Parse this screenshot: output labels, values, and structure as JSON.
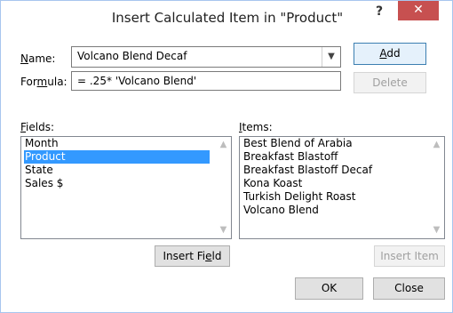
{
  "window": {
    "title": "Insert Calculated Item in \"Product\"",
    "help_label": "?",
    "close_label": "✕"
  },
  "form": {
    "name_label": "Name:",
    "name_value": "Volcano Blend Decaf",
    "formula_label": "Formula:",
    "formula_value": "= .25* 'Volcano Blend'"
  },
  "buttons": {
    "add": "Add",
    "delete": "Delete",
    "insert_field": "Insert Field",
    "insert_item": "Insert Item",
    "ok": "OK",
    "close": "Close"
  },
  "fields": {
    "label": "Fields:",
    "items": [
      "Month",
      "Product",
      "State",
      "Sales $"
    ],
    "selected": "Product"
  },
  "items": {
    "label": "Items:",
    "items": [
      "Best Blend of Arabia",
      "Breakfast Blastoff",
      "Breakfast Blastoff Decaf",
      "Kona Koast",
      "Turkish Delight Roast",
      "Volcano Blend"
    ]
  },
  "icons": {
    "dropdown": "chevron-down-icon",
    "scroll_up": "scroll-up-icon",
    "scroll_down": "scroll-down-icon"
  },
  "colors": {
    "selection": "#3399ff",
    "close_button": "#c75050",
    "default_button_border": "#3c7fb1"
  }
}
